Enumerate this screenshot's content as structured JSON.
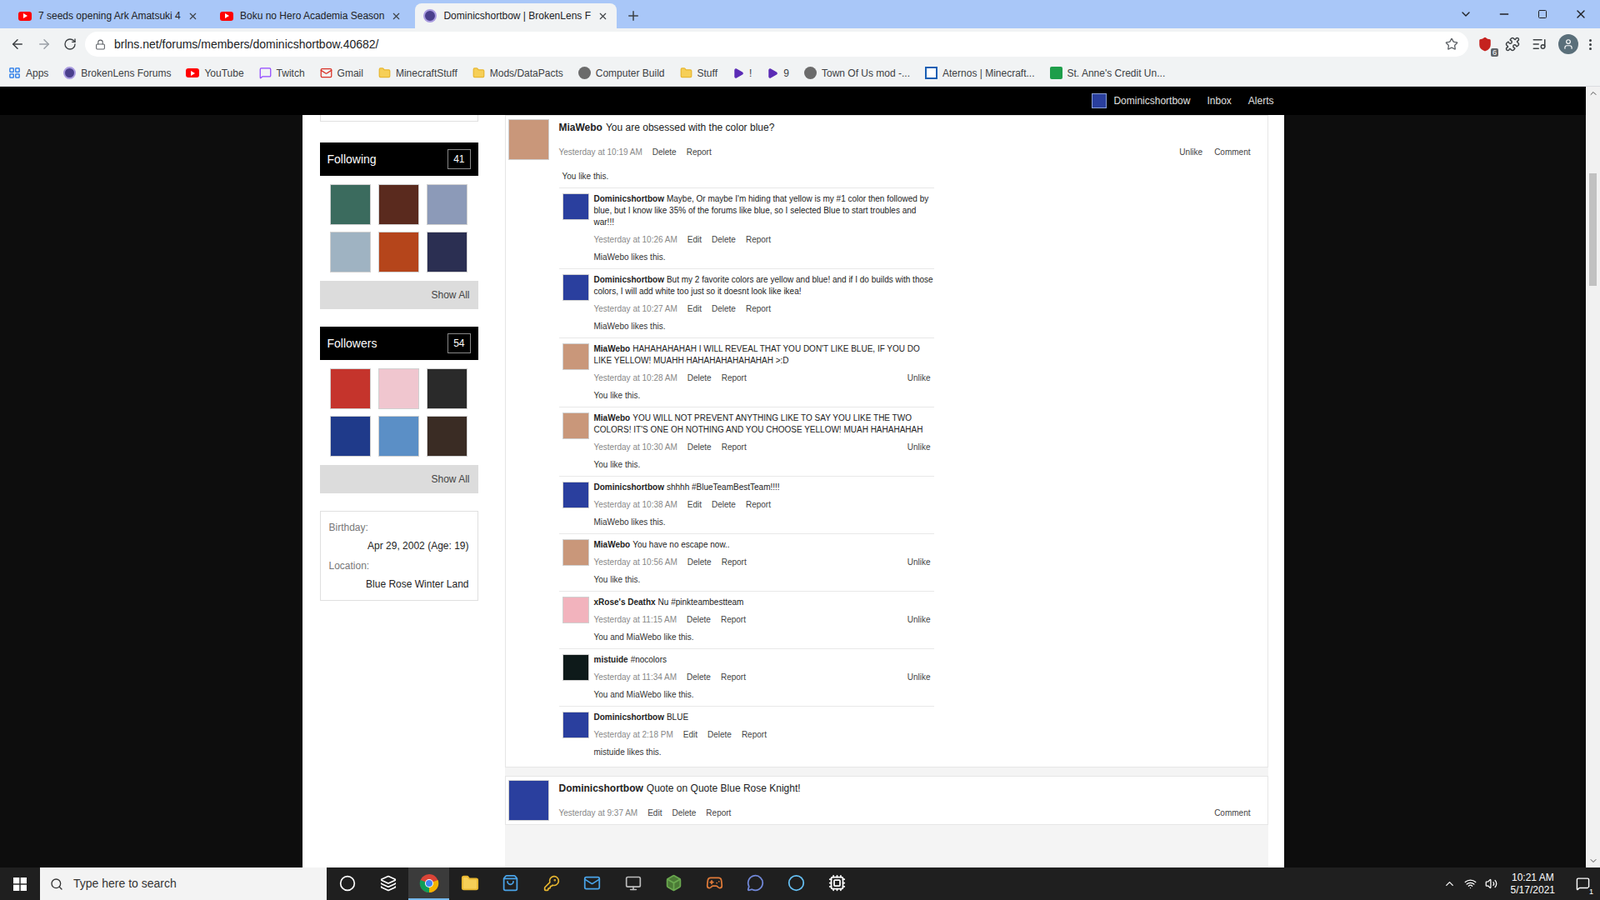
{
  "browser": {
    "tabs": [
      {
        "label": "7 seeds opening Ark Amatsuki 4",
        "kind": "youtube",
        "selected": false
      },
      {
        "label": "Boku no Hero Academia Season",
        "kind": "youtube",
        "selected": false
      },
      {
        "label": "Dominicshortbow | BrokenLens F",
        "kind": "forum",
        "selected": true
      }
    ],
    "url": "brlns.net/forums/members/dominicshortbow.40682/",
    "extension_badge": "6",
    "bookmarks": [
      {
        "label": "Apps",
        "kind": "apps"
      },
      {
        "label": "BrokenLens Forums",
        "kind": "forum"
      },
      {
        "label": "YouTube",
        "kind": "youtube"
      },
      {
        "label": "Twitch",
        "kind": "twitch"
      },
      {
        "label": "Gmail",
        "kind": "gmail"
      },
      {
        "label": "MinecraftStuff",
        "kind": "folder"
      },
      {
        "label": "Mods/DataPacts",
        "kind": "folder"
      },
      {
        "label": "Computer Build",
        "kind": "site"
      },
      {
        "label": "Stuff",
        "kind": "folder"
      },
      {
        "label": "!",
        "kind": "play"
      },
      {
        "label": "9",
        "kind": "play"
      },
      {
        "label": "Town Of Us mod -...",
        "kind": "site"
      },
      {
        "label": "Aternos | Minecraft...",
        "kind": "aternos"
      },
      {
        "label": "St. Anne's Credit Un...",
        "kind": "bank"
      }
    ]
  },
  "site_nav": {
    "user": "Dominicshortbow",
    "links": [
      "Inbox",
      "Alerts"
    ]
  },
  "sidebar": {
    "boxes": [
      {
        "title": "Following",
        "count": "41",
        "show_all": "Show All"
      },
      {
        "title": "Followers",
        "count": "54",
        "show_all": "Show All"
      }
    ],
    "info": [
      {
        "label": "Birthday:",
        "value": "Apr 29, 2002 (Age: 19)"
      },
      {
        "label": "Location:",
        "value": "Blue Rose Winter Land"
      }
    ]
  },
  "posts": [
    {
      "author": "MiaWebo",
      "text": "You are obsessed with the color blue?",
      "time": "Yesterday at 10:19 AM",
      "actions": [
        "Delete",
        "Report"
      ],
      "right_actions": [
        "Unlike",
        "Comment"
      ],
      "likes": "You like this.",
      "color": "#c9977a",
      "comments": [
        {
          "author": "Dominicshortbow",
          "text": "Maybe, Or maybe I'm hiding that yellow is my #1 color then followed by blue, but I know like 35% of the forums like blue, so I selected Blue to start troubles and war!!!",
          "time": "Yesterday at 10:26 AM",
          "actions": [
            "Edit",
            "Delete",
            "Report"
          ],
          "side_action": "",
          "likes": "MiaWebo likes this.",
          "color": "#2a3f9e"
        },
        {
          "author": "Dominicshortbow",
          "text": "But my 2 favorite colors are yellow and blue! and if I do builds with those colors, I will add white too just so it doesnt look like ikea!",
          "time": "Yesterday at 10:27 AM",
          "actions": [
            "Edit",
            "Delete",
            "Report"
          ],
          "side_action": "",
          "likes": "MiaWebo likes this.",
          "color": "#2a3f9e"
        },
        {
          "author": "MiaWebo",
          "text": "HAHAHAHAHAH I WILL REVEAL THAT YOU DON'T LIKE BLUE, IF YOU DO LIKE YELLOW! MUAHH HAHAHAHAHAHAHAH >:D",
          "time": "Yesterday at 10:28 AM",
          "actions": [
            "Delete",
            "Report"
          ],
          "side_action": "Unlike",
          "likes": "You like this.",
          "color": "#c9977a"
        },
        {
          "author": "MiaWebo",
          "text": "YOU WILL NOT PREVENT ANYTHING LIKE TO SAY YOU LIKE THE TWO COLORS! IT'S ONE OH NOTHING AND YOU CHOOSE YELLOW! MUAH HAHAHAHAH",
          "time": "Yesterday at 10:30 AM",
          "actions": [
            "Delete",
            "Report"
          ],
          "side_action": "Unlike",
          "likes": "You like this.",
          "color": "#c9977a"
        },
        {
          "author": "Dominicshortbow",
          "text": "shhhh #BlueTeamBestTeam!!!!",
          "time": "Yesterday at 10:38 AM",
          "actions": [
            "Edit",
            "Delete",
            "Report"
          ],
          "side_action": "",
          "likes": "MiaWebo likes this.",
          "color": "#2a3f9e"
        },
        {
          "author": "MiaWebo",
          "text": "You have no escape now..",
          "time": "Yesterday at 10:56 AM",
          "actions": [
            "Delete",
            "Report"
          ],
          "side_action": "Unlike",
          "likes": "You like this.",
          "color": "#c9977a"
        },
        {
          "author": "xRose's Deathx",
          "text": "Nu #pinkteambestteam",
          "time": "Yesterday at 11:15 AM",
          "actions": [
            "Delete",
            "Report"
          ],
          "side_action": "Unlike",
          "likes": "You and MiaWebo like this.",
          "color": "#f2b3bd"
        },
        {
          "author": "mistuide",
          "text": "#nocolors",
          "time": "Yesterday at 11:34 AM",
          "actions": [
            "Delete",
            "Report"
          ],
          "side_action": "Unlike",
          "likes": "You and MiaWebo like this.",
          "color": "#0e1a1a"
        },
        {
          "author": "Dominicshortbow",
          "text": "BLUE",
          "time": "Yesterday at 2:18 PM",
          "actions": [
            "Edit",
            "Delete",
            "Report"
          ],
          "side_action": "",
          "likes": "mistuide likes this.",
          "color": "#2a3f9e"
        }
      ]
    },
    {
      "author": "Dominicshortbow",
      "text": "Quote on Quote Blue Rose Knight!",
      "time": "Yesterday at 9:37 AM",
      "actions": [
        "Edit",
        "Delete",
        "Report"
      ],
      "right_actions": [
        "Comment"
      ],
      "likes": "",
      "color": "#2a3f9e",
      "comments": []
    }
  ],
  "taskbar": {
    "search_placeholder": "Type here to search",
    "apps": [
      {
        "kind": "cortana",
        "active": false
      },
      {
        "kind": "taskview",
        "active": false
      },
      {
        "kind": "chrome",
        "active": true
      },
      {
        "kind": "explorer",
        "active": false
      },
      {
        "kind": "store",
        "active": false
      },
      {
        "kind": "keys",
        "active": false
      },
      {
        "kind": "mail",
        "active": false
      },
      {
        "kind": "box",
        "active": false
      },
      {
        "kind": "minecraft",
        "active": false
      },
      {
        "kind": "game",
        "active": false
      },
      {
        "kind": "discord",
        "active": false
      },
      {
        "kind": "steam",
        "active": false
      },
      {
        "kind": "cpuz",
        "active": false
      }
    ],
    "time": "10:21 AM",
    "date": "5/17/2021",
    "notifications": "1"
  }
}
